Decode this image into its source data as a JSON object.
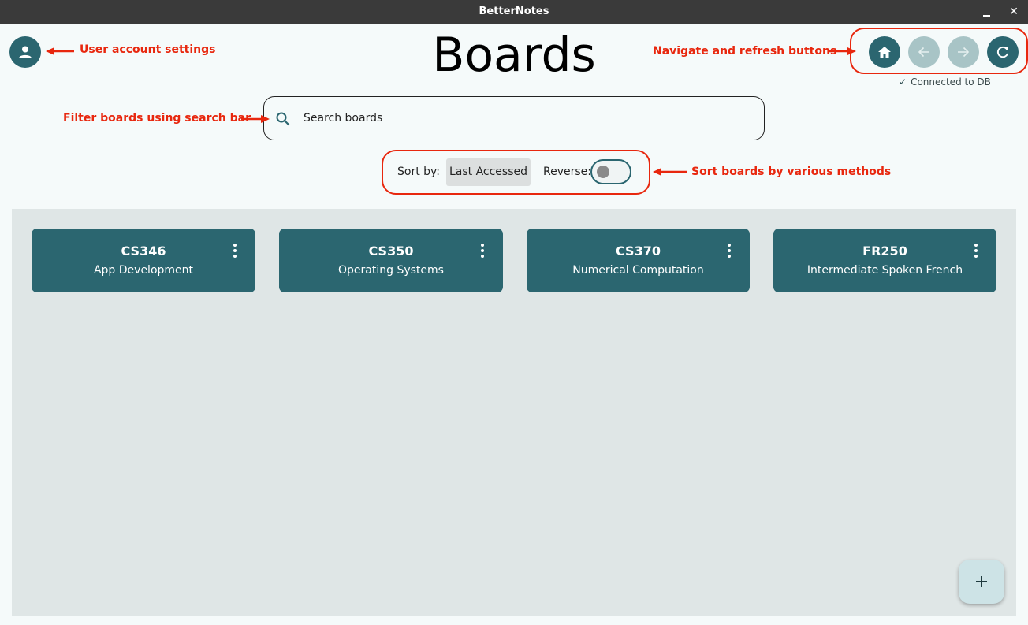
{
  "window": {
    "title": "BetterNotes"
  },
  "header": {
    "title": "Boards"
  },
  "status": {
    "text": "Connected to DB"
  },
  "search": {
    "placeholder": "Search boards"
  },
  "sort": {
    "label": "Sort by:",
    "selected": "Last Accessed",
    "reverse_label": "Reverse:",
    "reverse_on": false
  },
  "boards": [
    {
      "code": "CS346",
      "name": "App Development"
    },
    {
      "code": "CS350",
      "name": "Operating Systems"
    },
    {
      "code": "CS370",
      "name": "Numerical Computation"
    },
    {
      "code": "FR250",
      "name": "Intermediate Spoken French"
    }
  ],
  "annotations": {
    "account": "User account settings",
    "nav": "Navigate and refresh buttons",
    "search": "Filter boards using search bar",
    "sort": "Sort boards by various methods"
  },
  "colors": {
    "primary": "#2b6670",
    "disabled": "#a8c4c6",
    "annotation": "#e8270e",
    "background": "#f5fafa",
    "board_area": "#dfe6e6"
  },
  "icons": [
    "account-icon",
    "home-icon",
    "back-arrow-icon",
    "forward-arrow-icon",
    "refresh-icon",
    "search-icon",
    "more-vert-icon",
    "add-icon",
    "check-icon"
  ]
}
